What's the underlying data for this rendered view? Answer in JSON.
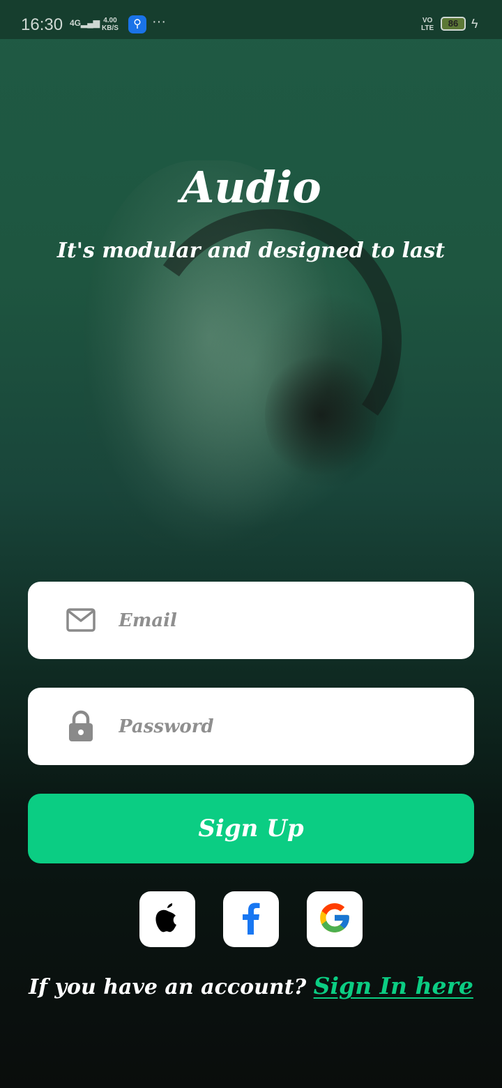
{
  "status_bar": {
    "time": "16:30",
    "network": "4G",
    "speed_value": "4.00",
    "speed_unit": "KB/S",
    "more": "···",
    "volte_top": "VO",
    "volte_bottom": "LTE",
    "battery": "86"
  },
  "header": {
    "title": "Audio",
    "subtitle": "It's modular and designed to last"
  },
  "form": {
    "email_placeholder": "Email",
    "password_placeholder": "Password",
    "email_icon": "mail-icon",
    "password_icon": "lock-icon",
    "submit_label": "Sign Up"
  },
  "social": {
    "items": [
      {
        "name": "apple",
        "icon": "apple-icon"
      },
      {
        "name": "facebook",
        "icon": "facebook-icon"
      },
      {
        "name": "google",
        "icon": "google-icon"
      }
    ]
  },
  "footer": {
    "prompt": "If you have an account? ",
    "link_label": "Sign In here"
  },
  "colors": {
    "accent": "#0bcd83",
    "background_top": "#1f5a44",
    "facebook": "#1877f2"
  }
}
